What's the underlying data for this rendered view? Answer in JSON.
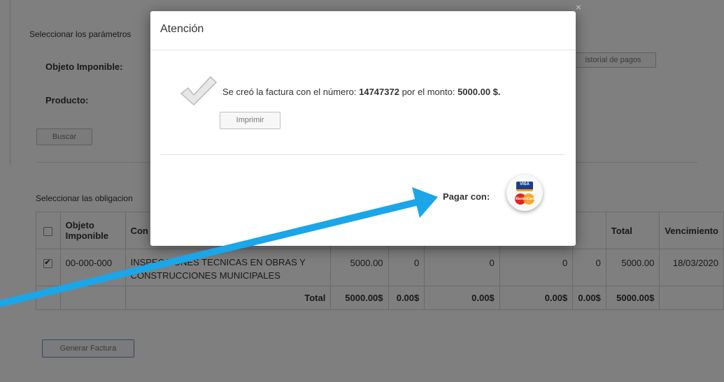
{
  "background": {
    "params_label": "Seleccionar los parámetros",
    "objeto_label": "Objeto Imponible:",
    "producto_label": "Producto:",
    "buscar_button": "Buscar",
    "historial_button": "istorial de pagos",
    "obligaciones_label": "Seleccionar las obligacion",
    "generar_button": "Generar Factura",
    "table": {
      "headers": [
        "Objeto Imponible",
        "Con",
        "Total",
        "Vencimiento"
      ],
      "row": {
        "objeto": "00-000-000",
        "concepto": "INSPECCIONES TECNICAS EN OBRAS Y CONSTRUCCIONES MUNICIPALES",
        "c1": "5000.00",
        "c2": "0",
        "c3": "0",
        "c4": "0",
        "c5": "0",
        "total": "5000.00",
        "vencimiento": "18/03/2020"
      },
      "totals": {
        "label": "Total",
        "c1": "5000.00$",
        "c2": "0.00$",
        "c3": "0.00$",
        "c4": "0.00$",
        "c5": "0.00$",
        "total": "5000.00$"
      }
    }
  },
  "modal": {
    "title": "Atención",
    "message_prefix": "Se creó la factura con el número: ",
    "invoice_number": "14747372",
    "message_middle": " por el monto: ",
    "amount": "5000.00 $.",
    "print_button": "Imprimir",
    "pay_label": "Pagar con:",
    "visa_text": "VISA",
    "mastercard_text": "MasterCard",
    "close_glyph": "×"
  },
  "colors": {
    "arrow": "#1aa6e8",
    "overlay": "rgba(0,0,0,0.5)"
  }
}
